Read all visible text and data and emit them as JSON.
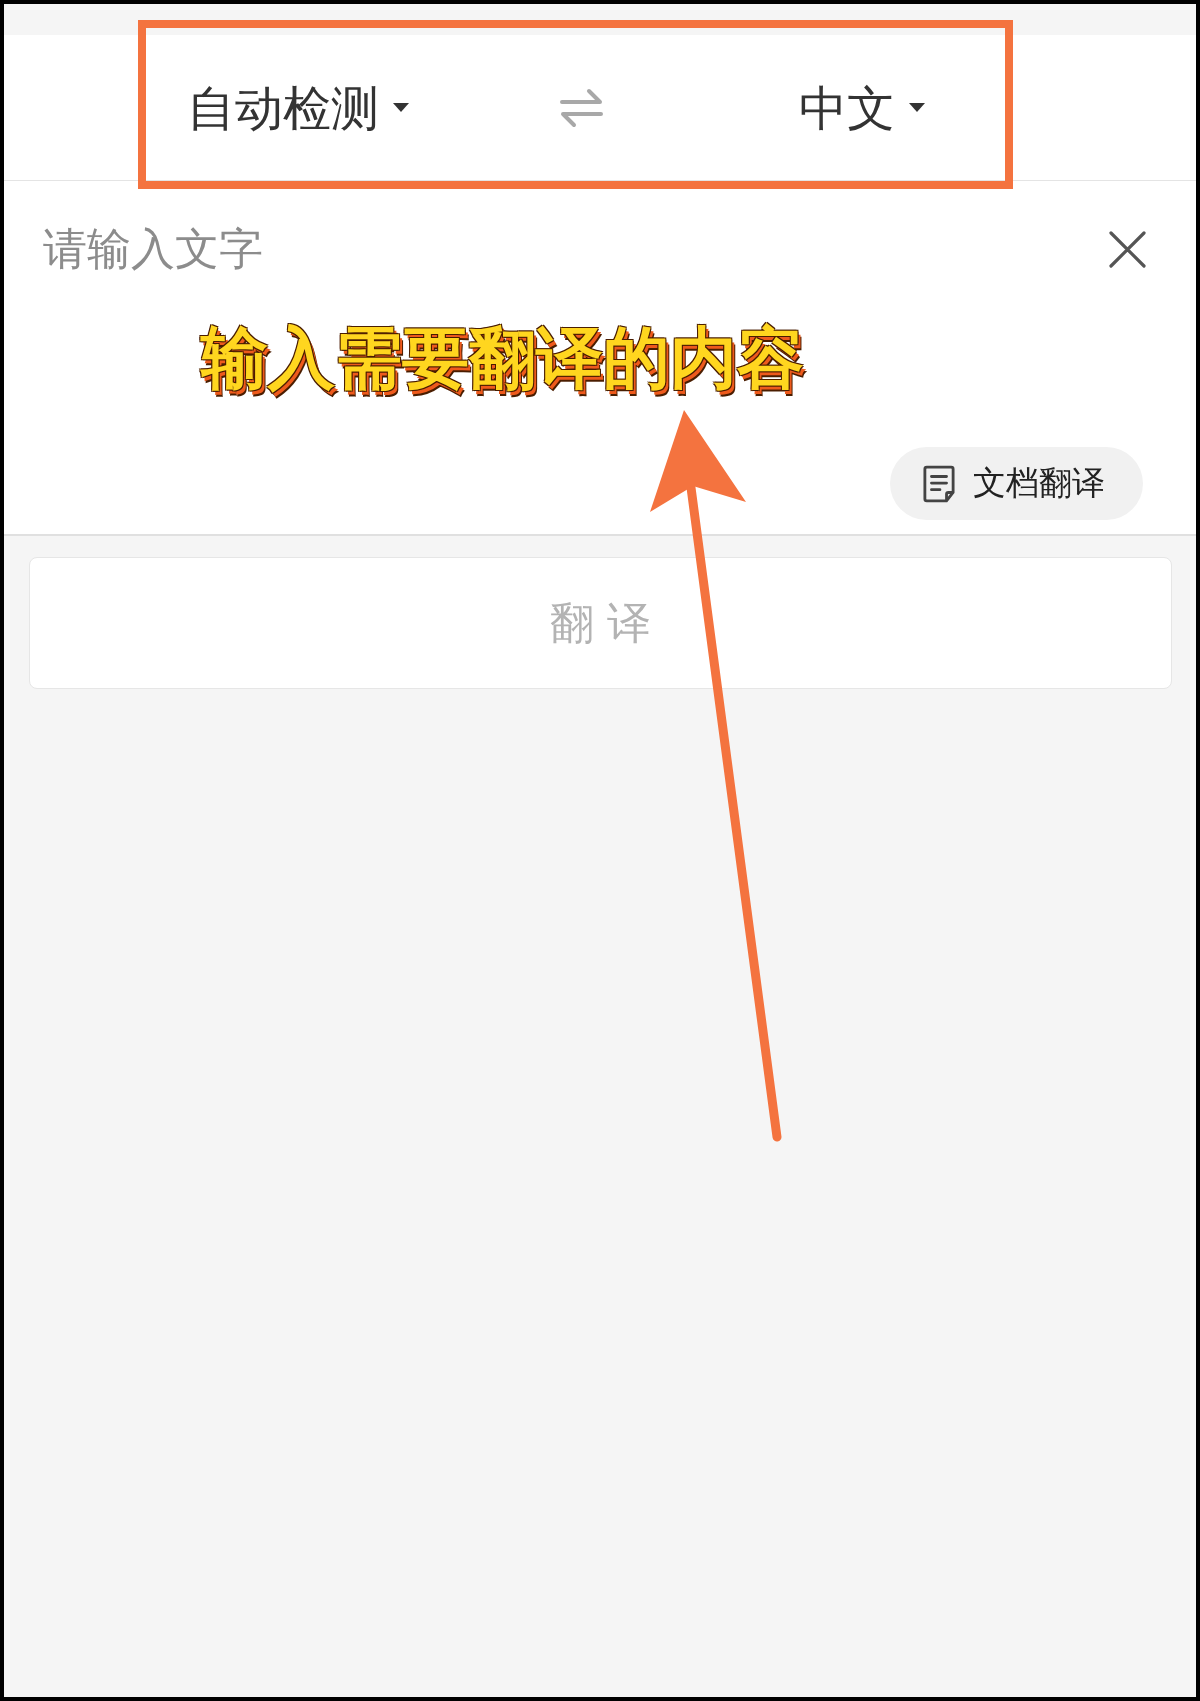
{
  "header": {
    "source_language": "自动检测",
    "target_language": "中文"
  },
  "input": {
    "placeholder": "请输入文字"
  },
  "document_button": {
    "label": "文档翻译"
  },
  "translate_button": {
    "label": "翻 译",
    "disabled": true
  },
  "annotation": {
    "caption": "输入需要翻译的内容"
  }
}
